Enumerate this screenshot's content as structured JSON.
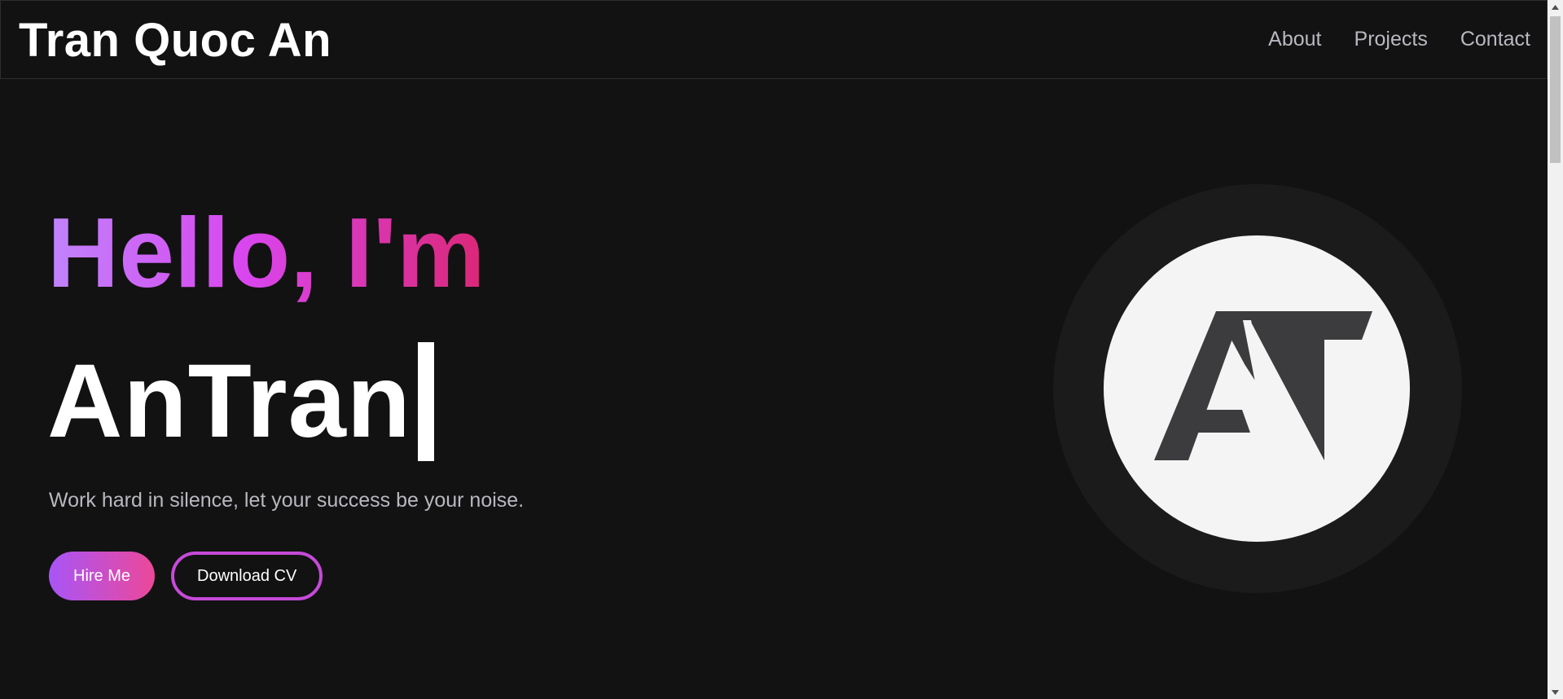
{
  "header": {
    "brand": "Tran Quoc An",
    "nav": [
      {
        "label": "About"
      },
      {
        "label": "Projects"
      },
      {
        "label": "Contact"
      }
    ]
  },
  "hero": {
    "greeting": "Hello, I'm",
    "name": "AnTran",
    "tagline": "Work hard in silence, let your success be your noise.",
    "buttons": {
      "primary": "Hire Me",
      "secondary": "Download CV"
    }
  },
  "avatar": {
    "logo_text": "AT",
    "icon": "at-monogram-logo"
  },
  "colors": {
    "background": "#121212",
    "gradient_start": "#c084fc",
    "gradient_end": "#db2777",
    "button_gradient_start": "#a855f7",
    "button_gradient_end": "#ec4899",
    "nav_text": "#b8b8c0",
    "logo_fill": "#3c3c3e"
  },
  "scrollbar": {
    "icons": [
      "chevron-up-icon",
      "chevron-down-icon"
    ]
  }
}
